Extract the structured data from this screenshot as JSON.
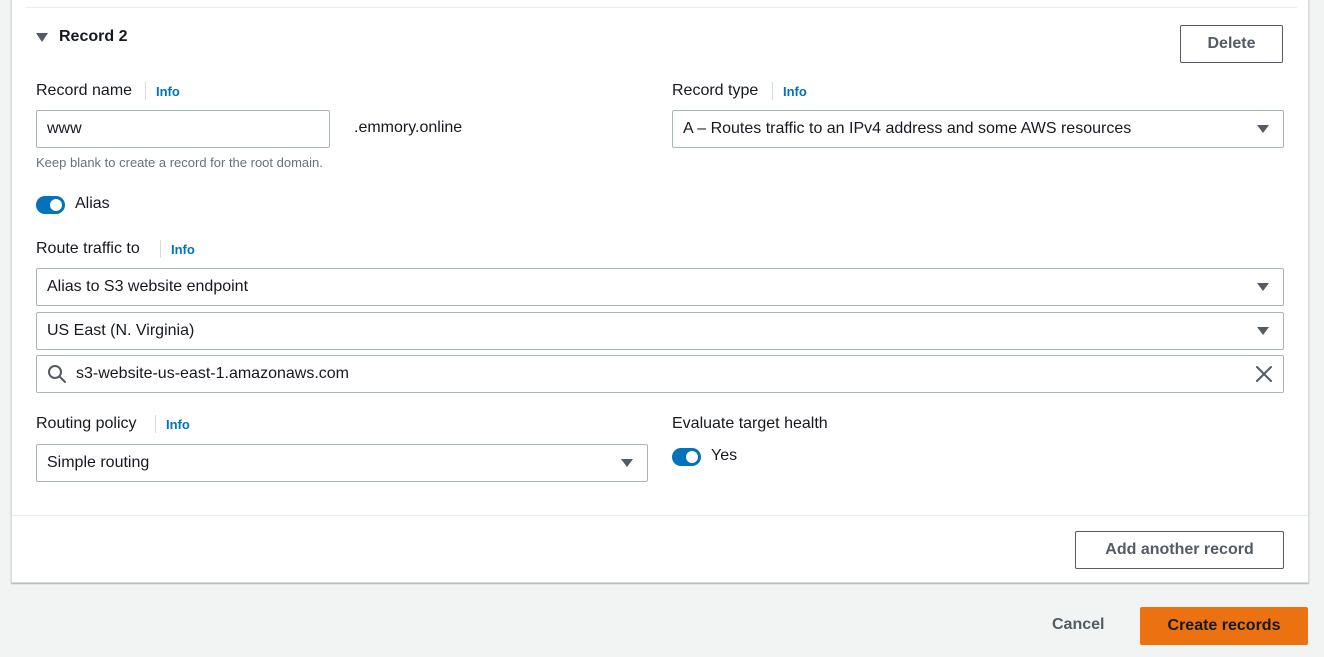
{
  "record": {
    "title": "Record 2",
    "delete_label": "Delete",
    "record_name": {
      "label": "Record name",
      "info": "Info",
      "value": "www",
      "suffix": ".emmory.online",
      "hint": "Keep blank to create a record for the root domain."
    },
    "record_type": {
      "label": "Record type",
      "info": "Info",
      "value": "A – Routes traffic to an IPv4 address and some AWS resources"
    },
    "alias": {
      "label": "Alias",
      "enabled": true
    },
    "route_traffic": {
      "label": "Route traffic to",
      "info": "Info",
      "endpoint_type": "Alias to S3 website endpoint",
      "region": "US East (N. Virginia)",
      "endpoint_value": "s3-website-us-east-1.amazonaws.com"
    },
    "routing_policy": {
      "label": "Routing policy",
      "info": "Info",
      "value": "Simple routing"
    },
    "evaluate_health": {
      "label": "Evaluate target health",
      "toggle_label": "Yes",
      "enabled": true
    },
    "add_another_label": "Add another record"
  },
  "footer": {
    "cancel_label": "Cancel",
    "create_label": "Create records"
  },
  "colors": {
    "accent": "#0073bb",
    "primary_button": "#ec7211"
  }
}
